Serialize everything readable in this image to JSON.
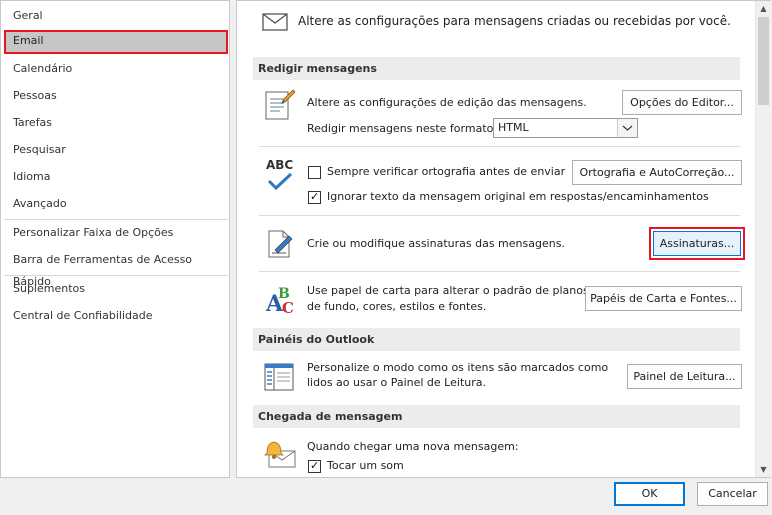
{
  "sidebar": {
    "items": [
      {
        "label": "Geral"
      },
      {
        "label": "Email"
      },
      {
        "label": "Calendário"
      },
      {
        "label": "Pessoas"
      },
      {
        "label": "Tarefas"
      },
      {
        "label": "Pesquisar"
      },
      {
        "label": "Idioma"
      },
      {
        "label": "Avançado"
      },
      {
        "label": "Personalizar Faixa de Opções"
      },
      {
        "label": "Barra de Ferramentas de Acesso Rápido"
      },
      {
        "label": "Suplementos"
      },
      {
        "label": "Central de Confiabilidade"
      }
    ],
    "selected": "Email"
  },
  "main": {
    "intro": "Altere as configurações para mensagens criadas ou recebidas por você.",
    "compose": {
      "heading": "Redigir mensagens",
      "edit_text": "Altere as configurações de edição das mensagens.",
      "editor_button": "Opções do Editor...",
      "format_label": "Redigir mensagens neste formato:",
      "format_value": "HTML",
      "spell_check_label": "Sempre verificar ortografia antes de enviar",
      "spell_check_checked": false,
      "spelling_button": "Ortografia e AutoCorreção...",
      "ignore_original_label": "Ignorar texto da mensagem original em respostas/encaminhamentos",
      "ignore_original_checked": true,
      "abc_label": "ABC",
      "signatures_text": "Crie ou modifique assinaturas das mensagens.",
      "signatures_button": "Assinaturas...",
      "stationery_text_1": "Use papel de carta para alterar o padrão de planos",
      "stationery_text_2": "de fundo, cores, estilos e fontes.",
      "stationery_button": "Papéis de Carta e Fontes..."
    },
    "panes": {
      "heading": "Painéis do Outlook",
      "text_1": "Personalize o modo como os itens são marcados como",
      "text_2": "lidos ao usar o Painel de Leitura.",
      "button": "Painel de Leitura..."
    },
    "arrival": {
      "heading": "Chegada de mensagem",
      "text": "Quando chegar uma nova mensagem:",
      "sound_label": "Tocar um som",
      "sound_checked": true
    }
  },
  "footer": {
    "ok": "OK",
    "cancel": "Cancelar"
  },
  "colors": {
    "highlight_red": "#e8141f",
    "accent_blue": "#0078d7"
  }
}
